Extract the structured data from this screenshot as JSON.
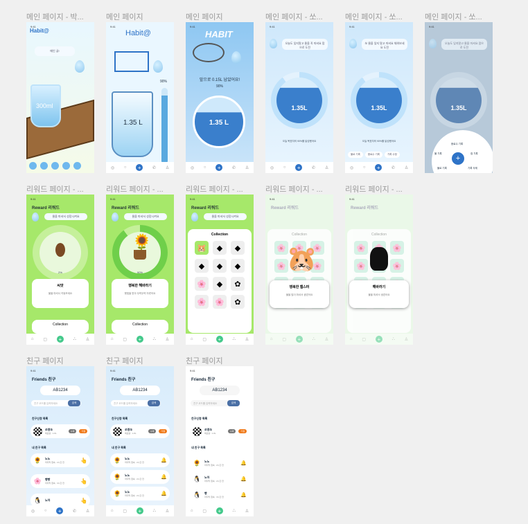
{
  "labels": {
    "r1": [
      "메인 페이지 - 박...",
      "메인 페이지",
      "메인 페이지",
      "메인 페이지 - 쏘...",
      "메인 페이지 - 쏘...",
      "메인 페이지 - 쏘..."
    ],
    "r2": [
      "리워드 페이지 - ...",
      "리워드 페이지 - ...",
      "리워드 페이지 - ...",
      "리워드 페이지 - ...",
      "리워드 페이지 - ..."
    ],
    "r3": [
      "친구 페이지",
      "친구 페이지",
      "친구 페이지"
    ]
  },
  "status_time": "9:41",
  "main1": {
    "logo": "Habit@",
    "bubble": "메인 글!",
    "cup_label": "300ml"
  },
  "main2": {
    "logo": "Habit@",
    "amount": "1.35 L",
    "percent": "90%"
  },
  "main3": {
    "logo": "HABIT",
    "message": "앞으로 0.15L 남았어요!",
    "percent": "90%",
    "amount": "1.35 L"
  },
  "main4": {
    "bubble": "오늘도 잊지말고 물을 꼭 마셔요 맘으로 도전",
    "amount": "1.35L",
    "goal": "오늘 목표치의 90%를 달성했어요"
  },
  "main5": {
    "bubble": "쏘 물을 잊지 말고 마셔요 채워보세요 도전",
    "amount": "1.35L",
    "goal": "오늘 목표치의 90%를 달성했어요",
    "chips": [
      "물로 기록",
      "음료수 기록",
      "기록 수정"
    ]
  },
  "main6": {
    "bubble": "오늘도 잊지말고 물을 마셔요 맘으로 도전",
    "amount": "1.35L",
    "menu": [
      "음료수 기록",
      "물 기록",
      "컵 기록",
      "물로 기록",
      "기록 삭제"
    ]
  },
  "reward1": {
    "title": "Reward 리워드",
    "bubble": "물을 마셔서 성장시켜요",
    "percent": "2%",
    "card_title": "씨앗",
    "card_text": "물을 마셔서 키워보세요",
    "collection": "Collection"
  },
  "reward2": {
    "title": "Reward 리워드",
    "bubble": "물을 마셔서 성장시켜요",
    "percent": "90%",
    "card_title": "행복한 해바라기",
    "card_text": "햇빛을 받아 무럭무럭 자랐어요",
    "collection": "Collection"
  },
  "reward3": {
    "title": "Reward 리워드",
    "bubble": "물을 마셔서 성장시켜요",
    "collection": "Collection"
  },
  "reward4": {
    "title": "Reward 리워드",
    "collection": "Collection",
    "card_title": "행복한 햄스터",
    "card_text": "물을 많이 마셔서 생겼어요"
  },
  "reward5": {
    "title": "Reward 리워드",
    "collection": "Collection",
    "card_title": "해바라기",
    "card_text": "물을 마셔서 생겼어요"
  },
  "friends": {
    "title": "Friends 친구",
    "code": "AB1234",
    "search_placeholder": "친구 코드를 입력하세요",
    "search_btn": "검색",
    "req_section": "친구신청 목록",
    "req_name": "쏘영쏘",
    "req_sub": "목표량 : 1.8L",
    "accept": "수락",
    "reject": "거절",
    "list_section": "내 친구 목록",
    "friends": [
      {
        "name": "노노",
        "sub": "마지막 접속 : 2시간 전"
      },
      {
        "name": "빵빵",
        "sub": "마지막 접속 : 3시간 전"
      },
      {
        "name": "노아",
        "sub": "마지막 접속 : 2시간 전"
      }
    ],
    "friends3": [
      {
        "name": "노노",
        "sub": "마지막 접속 : 2시간 전"
      },
      {
        "name": "노아",
        "sub": "마지막 접속 : 2시간 전"
      },
      {
        "name": "빵",
        "sub": "마지막 접속 : 3시간 전"
      }
    ]
  },
  "colors": {
    "blue": "#2e73c7",
    "green": "#44c98b",
    "reward_bg": "#a6e86a",
    "sky": "#d8ecfb"
  }
}
